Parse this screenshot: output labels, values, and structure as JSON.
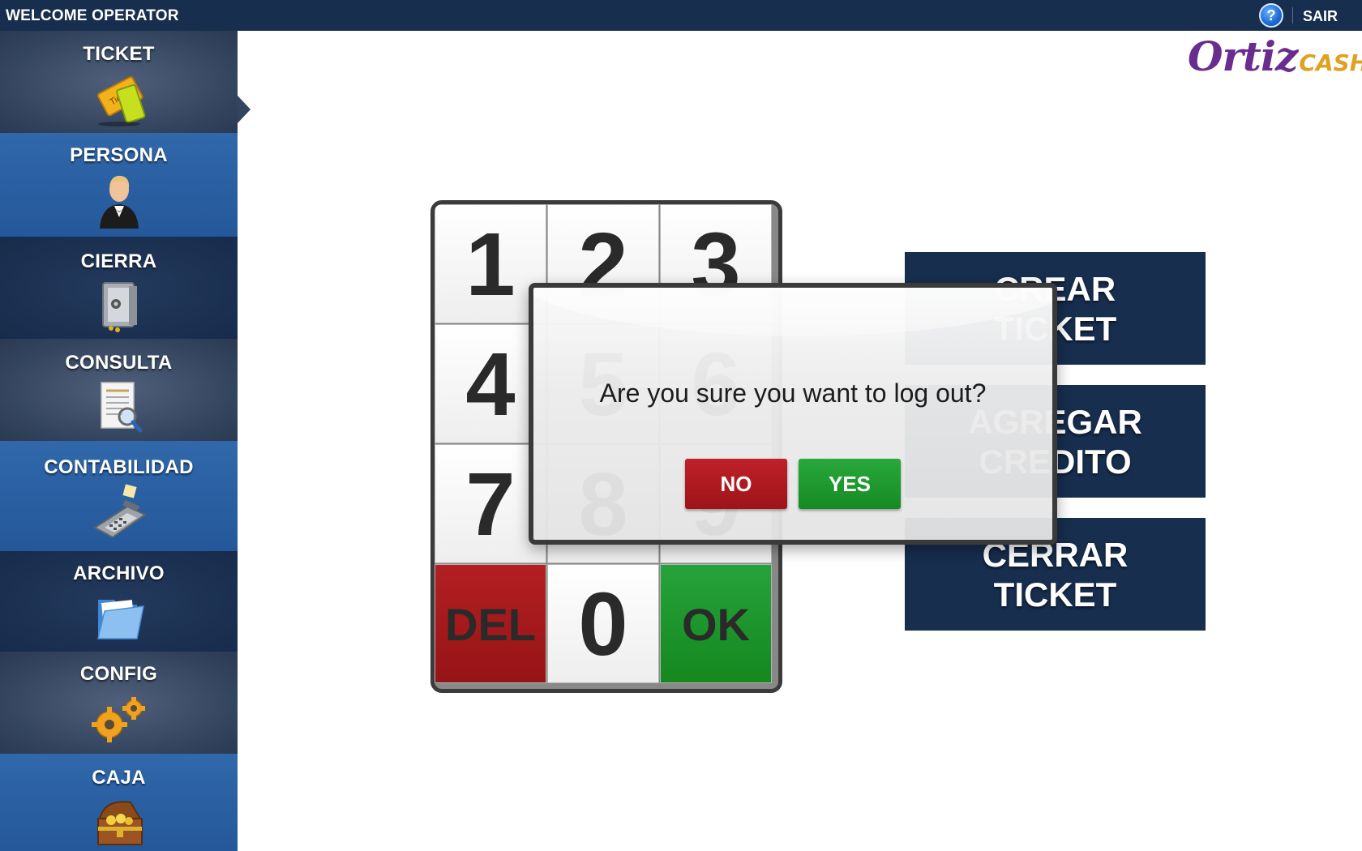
{
  "topbar": {
    "welcome": "WELCOME OPERATOR",
    "help_symbol": "?",
    "logout_label": "SAIR"
  },
  "logo": {
    "part1": "Ortiz",
    "part2": "CASH"
  },
  "sidebar": {
    "active_item": "TICKET",
    "items": [
      {
        "label": "TICKET",
        "icon": "ticket-icon"
      },
      {
        "label": "PERSONA",
        "icon": "person-icon"
      },
      {
        "label": "CIERRA",
        "icon": "safe-icon"
      },
      {
        "label": "CONSULTA",
        "icon": "document-search-icon"
      },
      {
        "label": "CONTABILIDAD",
        "icon": "card-terminal-icon"
      },
      {
        "label": "ARCHIVO",
        "icon": "folder-icon"
      },
      {
        "label": "CONFIG",
        "icon": "gears-icon"
      },
      {
        "label": "CAJA",
        "icon": "treasure-chest-icon"
      }
    ]
  },
  "keypad": {
    "keys": [
      "1",
      "2",
      "3",
      "4",
      "5",
      "6",
      "7",
      "8",
      "9",
      "DEL",
      "0",
      "OK"
    ]
  },
  "actions": {
    "create_ticket": [
      "CREAR",
      "TICKET"
    ],
    "add_credit": [
      "AGREGAR",
      "CREDITO"
    ],
    "close_ticket": [
      "CERRAR",
      "TICKET"
    ]
  },
  "dialog": {
    "message": "Are you sure you want to log out?",
    "no_label": "NO",
    "yes_label": "YES"
  },
  "colors": {
    "navy": "#172e4e",
    "sidebar_blue": "#2a5fa2",
    "danger_red": "#a8181c",
    "success_green": "#1c962c",
    "logo_purple": "#6a2c8e",
    "logo_gold": "#e0a020"
  }
}
